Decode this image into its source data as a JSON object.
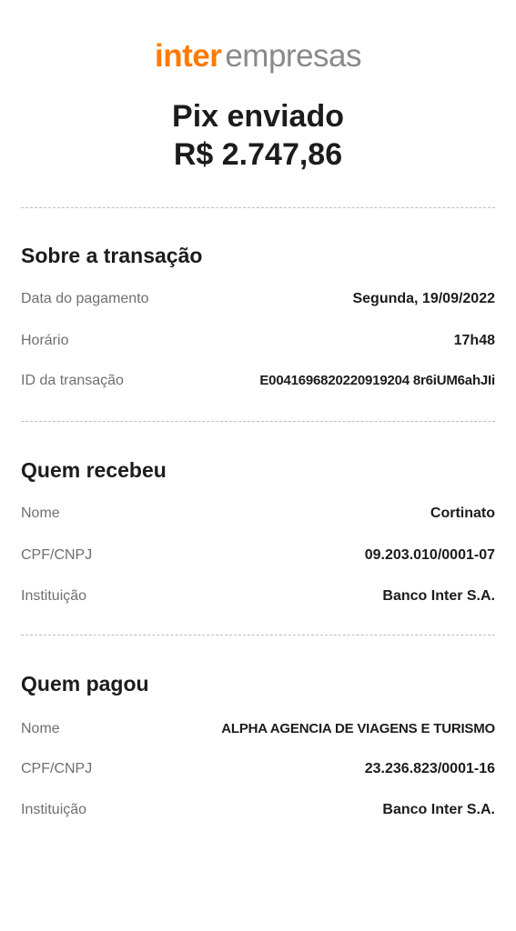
{
  "logo": {
    "brand": "inter",
    "suffix": "empresas"
  },
  "header": {
    "title": "Pix enviado",
    "amount": "R$ 2.747,86"
  },
  "transaction": {
    "title": "Sobre a transação",
    "payment_date_label": "Data do pagamento",
    "payment_date_value": "Segunda, 19/09/2022",
    "time_label": "Horário",
    "time_value": "17h48",
    "id_label": "ID da transação",
    "id_value": "E0041696820220919204 8r6iUM6ahJIi"
  },
  "receiver": {
    "title": "Quem recebeu",
    "name_label": "Nome",
    "name_value": "Cortinato",
    "doc_label": "CPF/CNPJ",
    "doc_value": "09.203.010/0001-07",
    "institution_label": "Instituição",
    "institution_value": "Banco Inter S.A."
  },
  "payer": {
    "title": "Quem pagou",
    "name_label": "Nome",
    "name_value": "ALPHA AGENCIA DE VIAGENS E TURISMO",
    "doc_label": "CPF/CNPJ",
    "doc_value": "23.236.823/0001-16",
    "institution_label": "Instituição",
    "institution_value": "Banco Inter S.A."
  },
  "colors": {
    "brand": "#ff7a00",
    "text": "#1c1c1c",
    "label": "#6f6f6f",
    "divider": "#bdbdbd"
  }
}
